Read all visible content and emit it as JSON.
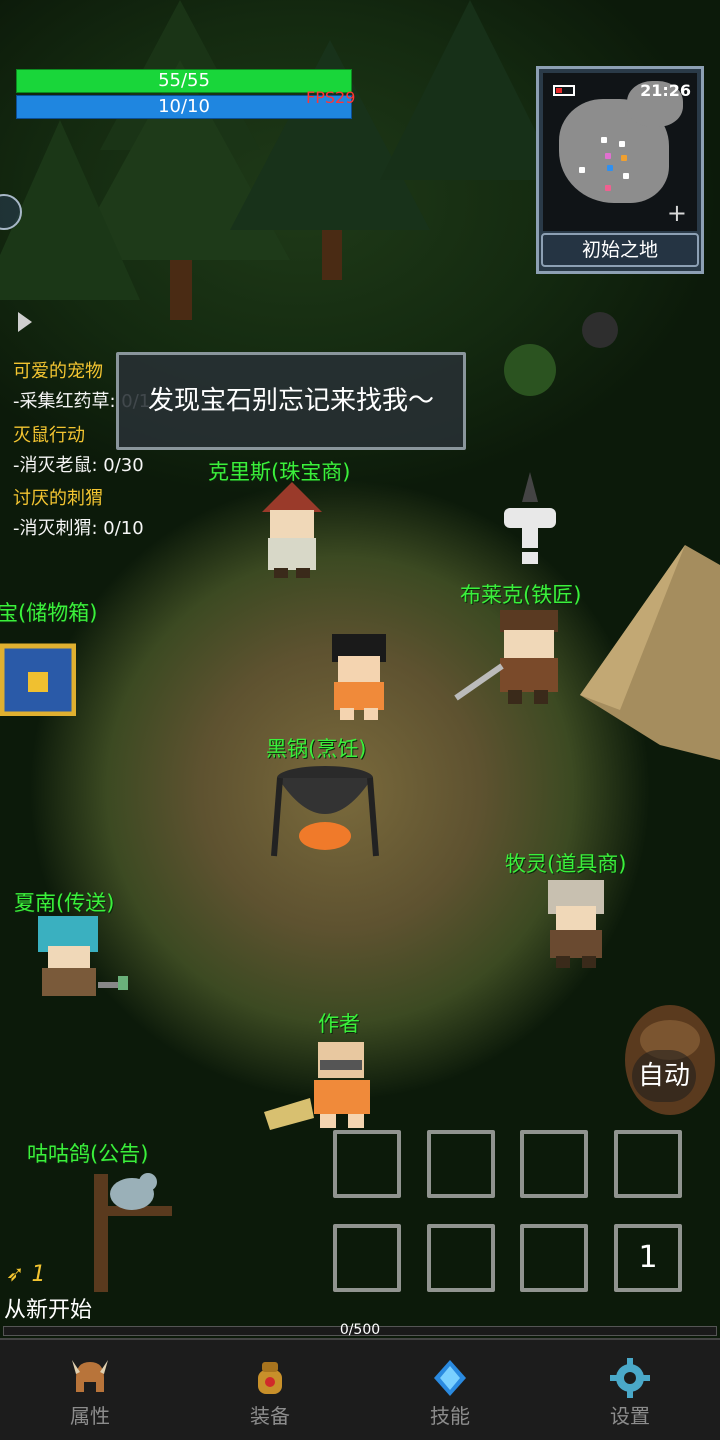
{
  "hud": {
    "hp": "55/55",
    "hp_fill": 1.0,
    "mp": "10/10",
    "mp_fill": 1.0,
    "fps": "FPS29"
  },
  "minimap": {
    "time": "21:26",
    "area_name": "初始之地"
  },
  "quests": [
    {
      "title": "可爱的宠物",
      "detail": "-采集红药草: 0/1"
    },
    {
      "title": "灭鼠行动",
      "detail": "-消灭老鼠: 0/30"
    },
    {
      "title": "讨厌的刺猬",
      "detail": "-消灭刺猬: 0/10"
    }
  ],
  "dialog": "发现宝石别忘记来找我～",
  "npcs": {
    "jeweler": "克里斯(珠宝商)",
    "blacksmith": "布莱克(铁匠)",
    "storage": "宝(储物箱)",
    "cooking": "黑锅(烹饪)",
    "item_shop": "牧灵(道具商)",
    "teleport": "夏南(传送)",
    "author": "作者",
    "announcement": "咕咕鸽(公告)"
  },
  "controls": {
    "auto": "自动",
    "slot_count": "1",
    "key_count": "1",
    "restart": "从新开始"
  },
  "xp": {
    "label": "0/500",
    "fill": 0
  },
  "nav": [
    {
      "label": "属性",
      "icon": "helmet-icon"
    },
    {
      "label": "装备",
      "icon": "bag-icon"
    },
    {
      "label": "技能",
      "icon": "crystal-icon"
    },
    {
      "label": "设置",
      "icon": "gear-icon"
    }
  ]
}
